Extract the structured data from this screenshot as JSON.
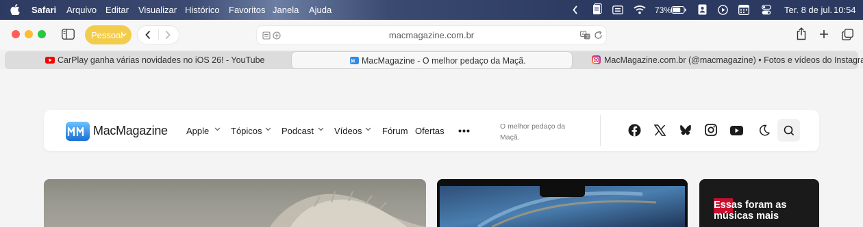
{
  "menubar": {
    "app": "Safari",
    "menus": [
      "Arquivo",
      "Editar",
      "Visualizar",
      "Histórico",
      "Favoritos",
      "Janela",
      "Ajuda"
    ],
    "battery": "73%",
    "date": "Ter. 8 de jul.",
    "time": "10:54",
    "icons": [
      "apple-icon",
      "chevron-left-icon",
      "note-icon",
      "keyboard-icon",
      "wifi-icon",
      "battery-icon",
      "contacts-icon",
      "play-icon",
      "calendar-icon",
      "control-center-icon"
    ]
  },
  "toolbar": {
    "profile_label": "Pessoal",
    "url": "macmagazine.com.br"
  },
  "tabs": [
    {
      "label": "CarPlay ganha várias novidades no iOS 26! - YouTube",
      "icon": "youtube-icon"
    },
    {
      "label": "MacMagazine - O melhor pedaço da Maçã.",
      "icon": "macmagazine-icon"
    },
    {
      "label": "MacMagazine.com.br (@macmagazine) • Fotos e vídeos do Instagram",
      "icon": "instagram-icon"
    }
  ],
  "site": {
    "brand": "MacMagazine",
    "nav": [
      "Apple",
      "Tópicos",
      "Podcast",
      "Vídeos",
      "Fórum",
      "Ofertas"
    ],
    "tagline": "O melhor pedaço da Maçã.",
    "social": [
      "facebook-icon",
      "x-icon",
      "bluesky-icon",
      "instagram-icon",
      "youtube-icon",
      "moon-icon",
      "search-icon"
    ]
  },
  "cards": {
    "third_title": "Essas foram as músicas mais"
  },
  "colors": {
    "profile_accent": "#f4cc4c",
    "close": "#ff5f57",
    "minimize": "#febc2e",
    "zoom": "#28c840",
    "brand_blue": "#2f8be6"
  }
}
